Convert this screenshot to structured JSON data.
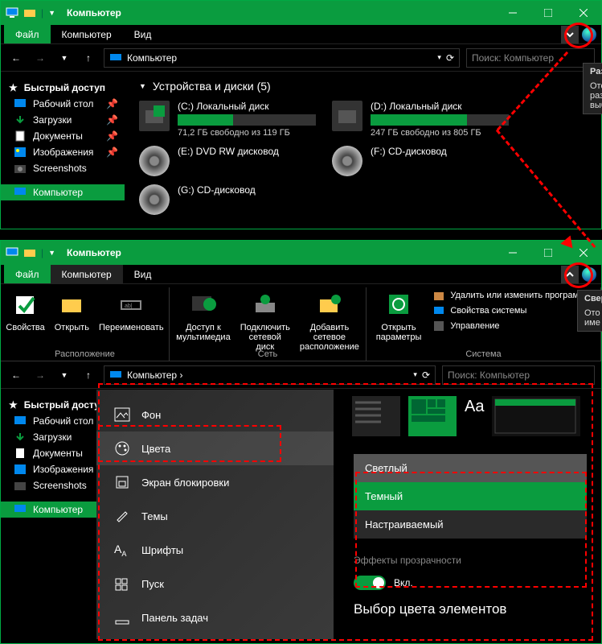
{
  "win1": {
    "title": "Компьютер",
    "menu": {
      "file": "Файл",
      "computer": "Компьютер",
      "view": "Вид"
    },
    "breadcrumb": "Компьютер",
    "search_placeholder": "Поиск: Компьютер",
    "tooltip": {
      "head": "Разве",
      "l1": "Ото",
      "l2": "раз",
      "l3": "выб"
    }
  },
  "sidebar": {
    "quick": "Быстрый доступ",
    "desktop": "Рабочий стол",
    "downloads": "Загрузки",
    "documents": "Документы",
    "pictures": "Изображения",
    "screenshots": "Screenshots",
    "computer": "Компьютер"
  },
  "section_header": "Устройства и диски (5)",
  "drives": {
    "c": {
      "label": "(C:) Локальный диск",
      "free": "71,2 ГБ свободно из 119 ГБ",
      "fill": 40
    },
    "d": {
      "label": "(D:) Локальный диск",
      "free": "247 ГБ свободно из 805 ГБ",
      "fill": 70
    },
    "e": {
      "label": "(E:) DVD RW дисковод"
    },
    "f": {
      "label": "(F:) CD-дисковод"
    },
    "g": {
      "label": "(G:) CD-дисковод"
    }
  },
  "win2": {
    "title": "Компьютер",
    "menu": {
      "file": "Файл",
      "computer": "Компьютер",
      "view": "Вид"
    },
    "breadcrumb": "Компьютер  ›",
    "search_placeholder": "Поиск: Компьютер",
    "tooltip": {
      "head": "Свер",
      "l1": "Ото",
      "l2": "име"
    }
  },
  "ribbon": {
    "properties": "Свойства",
    "open": "Открыть",
    "rename": "Переименовать",
    "location_group": "Расположение",
    "media": "Доступ к\nмультимедиа ",
    "netdrive": "Подключить\nсетевой диск ",
    "addnet": "Добавить сетевое\nрасположение",
    "network_group": "Сеть",
    "openctrl": "Открыть\nпараметры",
    "sys1": "Удалить или изменить программу",
    "sys2": "Свойства системы",
    "sys3": "Управление",
    "system_group": "Система"
  },
  "settings": {
    "background": "Фон",
    "colors": "Цвета",
    "lockscreen": "Экран блокировки",
    "themes": "Темы",
    "fonts": "Шрифты",
    "start": "Пуск",
    "taskbar": "Панель задач"
  },
  "color_panel": {
    "aa": "Aa",
    "light": "Светлый",
    "dark": "Темный",
    "custom": "Настраиваемый",
    "transparency": "Эффекты прозрачности",
    "on": "Вкл.",
    "header": "Выбор цвета элементов"
  }
}
